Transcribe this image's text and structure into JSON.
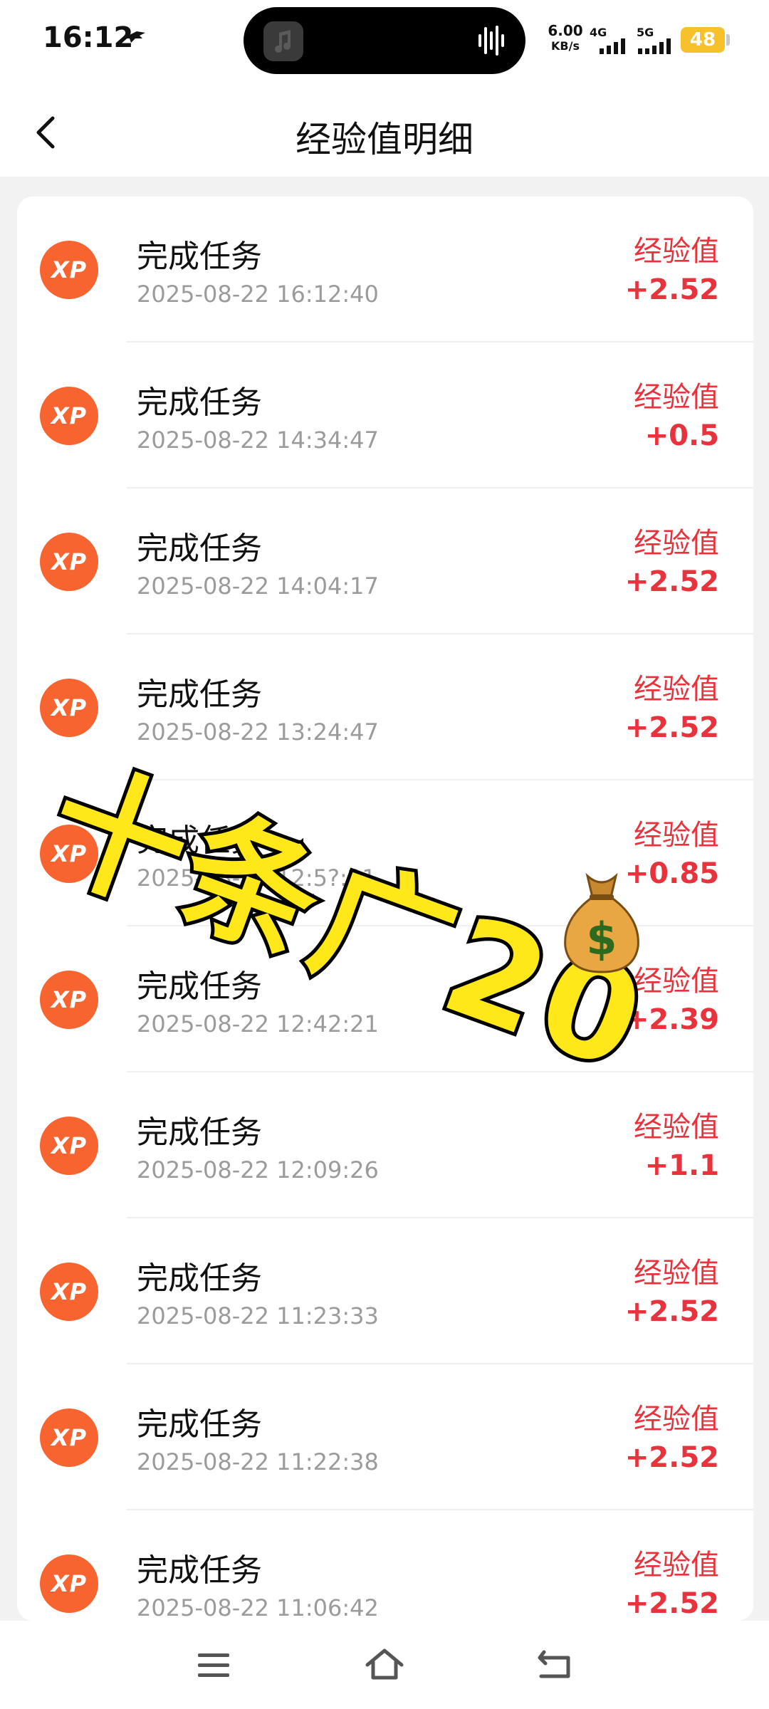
{
  "status_bar": {
    "time": "16:12",
    "net_speed_value": "6.00",
    "net_speed_unit": "KB/s",
    "signal_1_label": "4G",
    "signal_2_label": "5G",
    "battery": "48"
  },
  "header": {
    "title": "经验值明细",
    "back_icon": "chevron-left-icon"
  },
  "records": [
    {
      "title": "完成任务",
      "time": "2025-08-22 16:12:40",
      "label": "经验值",
      "value": "+2.52"
    },
    {
      "title": "完成任务",
      "time": "2025-08-22 14:34:47",
      "label": "经验值",
      "value": "+0.5"
    },
    {
      "title": "完成任务",
      "time": "2025-08-22 14:04:17",
      "label": "经验值",
      "value": "+2.52"
    },
    {
      "title": "完成任务",
      "time": "2025-08-22 13:24:47",
      "label": "经验值",
      "value": "+2.52"
    },
    {
      "title": "完成任务",
      "time": "2025-08-22 12:5?:21",
      "label": "经验值",
      "value": "+0.85"
    },
    {
      "title": "完成任务",
      "time": "2025-08-22 12:42:21",
      "label": "经验值",
      "value": "+2.39"
    },
    {
      "title": "完成任务",
      "time": "2025-08-22 12:09:26",
      "label": "经验值",
      "value": "+1.1"
    },
    {
      "title": "完成任务",
      "time": "2025-08-22 11:23:33",
      "label": "经验值",
      "value": "+2.52"
    },
    {
      "title": "完成任务",
      "time": "2025-08-22 11:22:38",
      "label": "经验值",
      "value": "+2.52"
    },
    {
      "title": "完成任务",
      "time": "2025-08-22 11:06:42",
      "label": "经验值",
      "value": "+2.52"
    }
  ],
  "xp_badge_text": "XP",
  "overlay": {
    "caption": "十条广20",
    "emoji_icon": "money-bag-icon"
  },
  "nav_bar": {
    "menu_icon": "menu-icon",
    "home_icon": "home-icon",
    "back_icon": "back-icon"
  },
  "colors": {
    "accent_red": "#e8323c",
    "xp_orange": "#f7642f",
    "overlay_yellow": "#ffe81a",
    "battery_yellow": "#f6c12a"
  }
}
